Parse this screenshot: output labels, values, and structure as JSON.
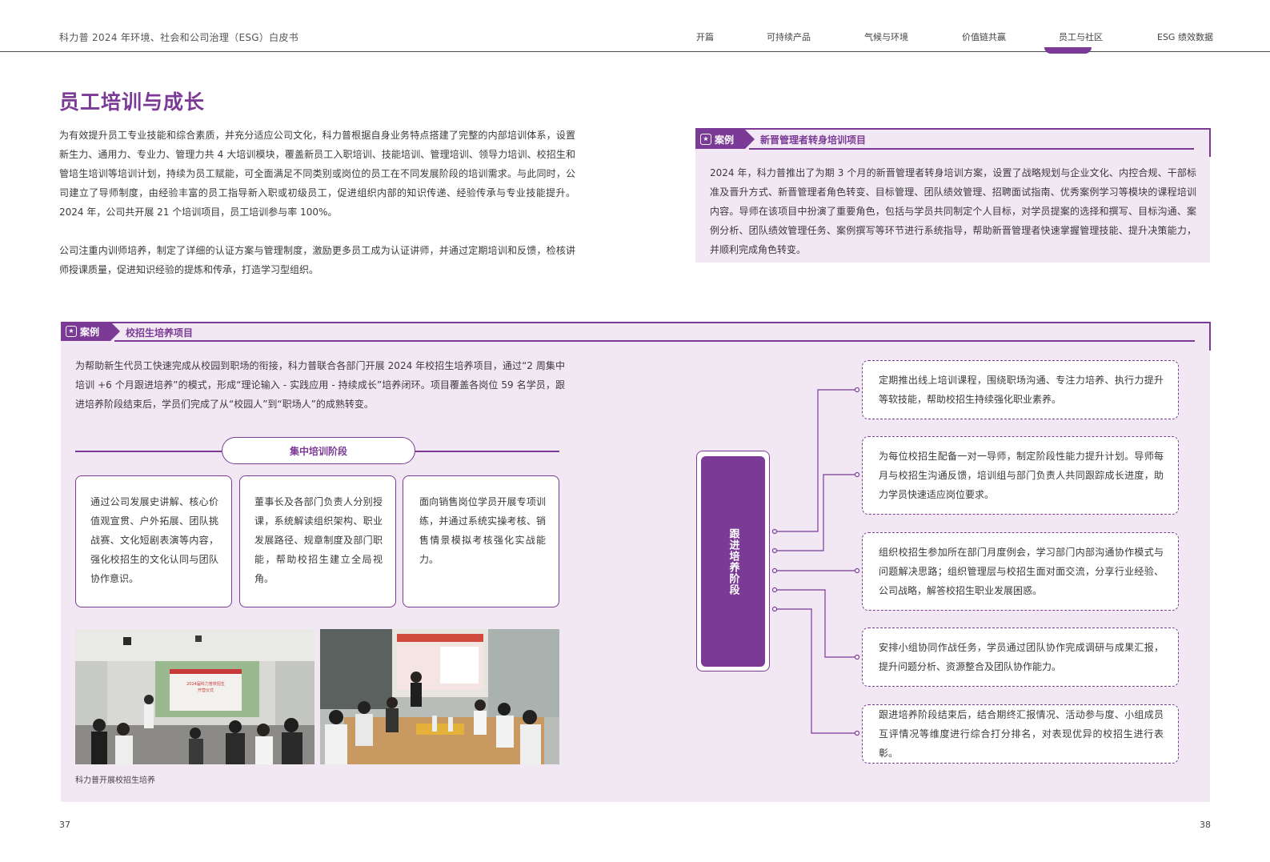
{
  "header": {
    "doc_title": "科力普 2024 年环境、社会和公司治理（ESG）白皮书",
    "nav": [
      {
        "label": "开篇",
        "active": false
      },
      {
        "label": "可持续产品",
        "active": false
      },
      {
        "label": "气候与环境",
        "active": false
      },
      {
        "label": "价值链共赢",
        "active": false
      },
      {
        "label": "员工与社区",
        "active": true
      },
      {
        "label": "ESG 绩效数据",
        "active": false
      }
    ]
  },
  "page_title": "员工培训与成长",
  "intro": {
    "para1": "为有效提升员工专业技能和综合素质，并充分适应公司文化，科力普根据自身业务特点搭建了完整的内部培训体系，设置新生力、通用力、专业力、管理力共 4 大培训模块，覆盖新员工入职培训、技能培训、管理培训、领导力培训、校招生和管培生培训等培训计划，持续为员工赋能，可全面满足不同类别或岗位的员工在不同发展阶段的培训需求。与此同时，公司建立了导师制度，由经验丰富的员工指导新入职或初级员工，促进组织内部的知识传递、经验传承与专业技能提升。2024 年，公司共开展 21 个培训项目，员工培训参与率 100%。",
    "para2": "公司注重内训师培养，制定了详细的认证方案与管理制度，激励更多员工成为认证讲师，并通过定期培训和反馈，检核讲师授课质量，促进知识经验的提炼和传承，打造学习型组织。"
  },
  "case_manager": {
    "badge": "案例",
    "heading": "新晋管理者转身培训项目",
    "text": "2024 年，科力普推出了为期 3 个月的新晋管理者转身培训方案，设置了战略规划与企业文化、内控合规、干部标准及晋升方式、新晋管理者角色转变、目标管理、团队绩效管理、招聘面试指南、优秀案例学习等模块的课程培训内容。导师在该项目中扮演了重要角色，包括与学员共同制定个人目标，对学员提案的选择和撰写、目标沟通、案例分析、团队绩效管理任务、案例撰写等环节进行系统指导，帮助新晋管理者快速掌握管理技能、提升决策能力，并顺利完成角色转变。"
  },
  "case_campus": {
    "badge": "案例",
    "heading": "校招生培养项目",
    "intro": "为帮助新生代员工快速完成从校园到职场的衔接，科力普联合各部门开展 2024 年校招生培养项目，通过“2 周集中培训 +6 个月跟进培养”的模式，形成“理论输入 - 实践应用 - 持续成长”培养闭环。项目覆盖各岗位 59 名学员，跟进培养阶段结束后，学员们完成了从“校园人”到“职场人”的成熟转变。",
    "phase_label": "集中培训阶段",
    "cards": [
      "通过公司发展史讲解、核心价值观宣贯、户外拓展、团队挑战赛、文化短剧表演等内容，强化校招生的文化认同与团队协作意识。",
      "董事长及各部门负责人分别授课，系统解读组织架构、职业发展路径、规章制度及部门职能，帮助校招生建立全局视角。",
      "面向销售岗位学员开展专项训练，并通过系统实操考核、销售情景模拟考核强化实战能力。"
    ],
    "photo1_slide_text": "2024届科力普校招生\n开营仪式",
    "caption": "科力普开展校招生培养",
    "stage_label": "跟进培养阶段",
    "follow": [
      "定期推出线上培训课程，围绕职场沟通、专注力培养、执行力提升等软技能，帮助校招生持续强化职业素养。",
      "为每位校招生配备一对一导师，制定阶段性能力提升计划。导师每月与校招生沟通反馈，培训组与部门负责人共同跟踪成长进度，助力学员快速适应岗位要求。",
      "组织校招生参加所在部门月度例会，学习部门内部沟通协作模式与问题解决思路；组织管理层与校招生面对面交流，分享行业经验、公司战略，解答校招生职业发展困惑。",
      "安排小组协同作战任务，学员通过团队协作完成调研与成果汇报，提升问题分析、资源整合及团队协作能力。",
      "跟进培养阶段结束后，结合期终汇报情况、活动参与度、小组成员互评情况等维度进行综合打分排名，对表现优异的校招生进行表彰。"
    ]
  },
  "page_numbers": {
    "left": "37",
    "right": "38"
  },
  "colors": {
    "accent": "#7b3a96",
    "panel": "#f1e8f3"
  }
}
